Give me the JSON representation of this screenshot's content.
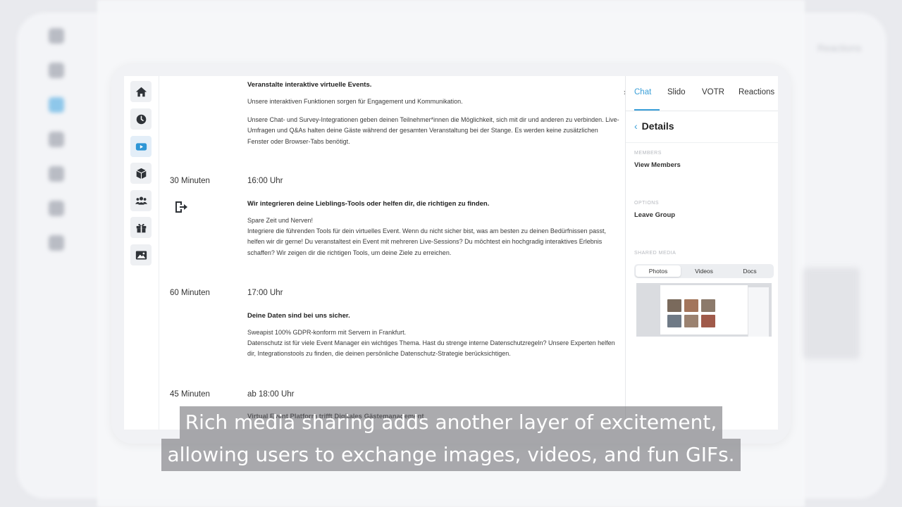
{
  "agenda": {
    "block0": {
      "heading": "Veranstalte interaktive virtuelle Events.",
      "p1": "Unsere interaktiven Funktionen sorgen für Engagement und Kommunikation.",
      "p2": "Unsere Chat- und Survey-Integrationen geben deinen Teilnehmer*innen die Möglichkeit, sich mit dir und anderen zu verbinden. Live-Umfragen und Q&As halten deine Gäste während der gesamten Veranstaltung bei der Stange. Es werden keine zusätzlichen Fenster oder Browser-Tabs benötigt."
    },
    "block1": {
      "duration": "30 Minuten",
      "time": "16:00 Uhr",
      "heading": "Wir integrieren deine Lieblings-Tools oder helfen dir, die richtigen zu finden.",
      "p1": "Spare Zeit und Nerven!",
      "p2": "Integriere die führenden Tools für dein virtuelles Event. Wenn du nicht sicher bist, was am besten zu deinen Bedürfnissen passt, helfen wir dir gerne! Du veranstaltest ein Event mit mehreren Live-Sessions? Du möchtest ein hochgradig interaktives Erlebnis schaffen? Wir zeigen dir die richtigen Tools, um deine Ziele zu erreichen."
    },
    "block2": {
      "duration": "60 Minuten",
      "time": "17:00 Uhr",
      "heading": "Deine Daten sind bei uns sicher.",
      "p1": "Sweapist 100% GDPR-konform mit Servern in Frankfurt.",
      "p2": "Datenschutz ist für viele Event Manager ein wichtiges Thema. Hast du strenge interne Datenschutzregeln? Unsere Experten helfen dir, Integrationstools zu finden, die deinen persönliche Datenschutz-Strategie berücksichtigen."
    },
    "block3": {
      "duration": "45 Minuten",
      "time": "ab 18:00 Uhr",
      "heading": "Virtual Event Platform trifft Digitales Gästemanagement"
    }
  },
  "panel": {
    "tabs": [
      "Chat",
      "Slido",
      "VOTR",
      "Reactions"
    ],
    "details_title": "Details",
    "members_label": "MEMBERS",
    "members_link": "View Members",
    "options_label": "OPTIONS",
    "options_link": "Leave Group",
    "shared_label": "SHARED MEDIA",
    "media_tabs": [
      "Photos",
      "Videos",
      "Docs"
    ]
  },
  "background": {
    "top_right": "Reactions"
  },
  "caption": {
    "line1": "Rich media sharing adds another layer of excitement,",
    "line2": "allowing users to exchange images, videos, and fun GIFs."
  },
  "colors": {
    "accent": "#3a9fd8",
    "active_icon": "#2e96d6"
  },
  "icons": [
    "home-icon",
    "clock-icon",
    "video-icon",
    "cube-icon",
    "users-icon",
    "gift-icon",
    "image-icon",
    "exit-icon",
    "chevron-right-icon",
    "back-chevron-icon"
  ]
}
